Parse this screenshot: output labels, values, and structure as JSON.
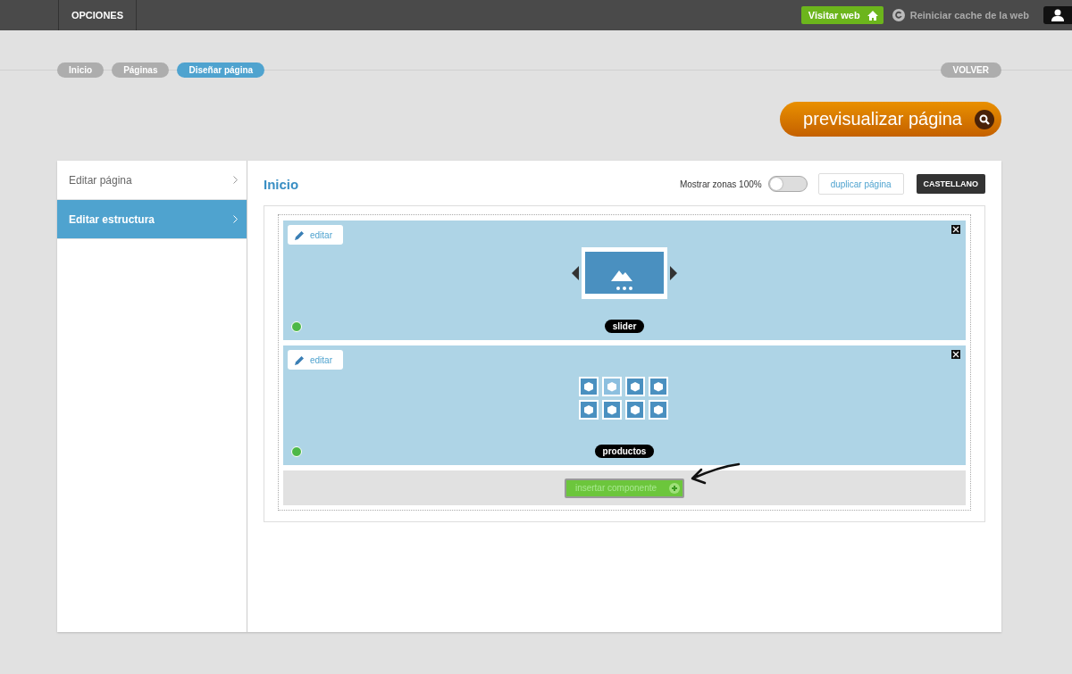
{
  "top_bar": {
    "menu": "OPCIONES",
    "visit_button": "Visitar web",
    "reset_cache": "Reiniciar cache de la web"
  },
  "breadcrumbs": [
    {
      "label": "Inicio",
      "selected": false
    },
    {
      "label": "Páginas",
      "selected": false
    },
    {
      "label": "Diseñar página",
      "selected": true
    }
  ],
  "back_button": "VOLVER",
  "preview_button": "previsualizar página",
  "sidebar": {
    "items": [
      {
        "label": "Editar página",
        "selected": false
      },
      {
        "label": "Editar estructura",
        "selected": true
      }
    ]
  },
  "page": {
    "title": "Inicio",
    "toggle_label": "Mostrar zonas 100%",
    "toggle_on": false,
    "duplicate_button": "duplicar página",
    "language_button": "CASTELLANO"
  },
  "components": [
    {
      "kind": "slider",
      "edit_button": "editar",
      "label": "slider",
      "color": "#4db848"
    },
    {
      "kind": "products",
      "edit_button": "editar",
      "label": "productos",
      "color": "#4db848"
    }
  ],
  "insert_button": "insertar componente"
}
